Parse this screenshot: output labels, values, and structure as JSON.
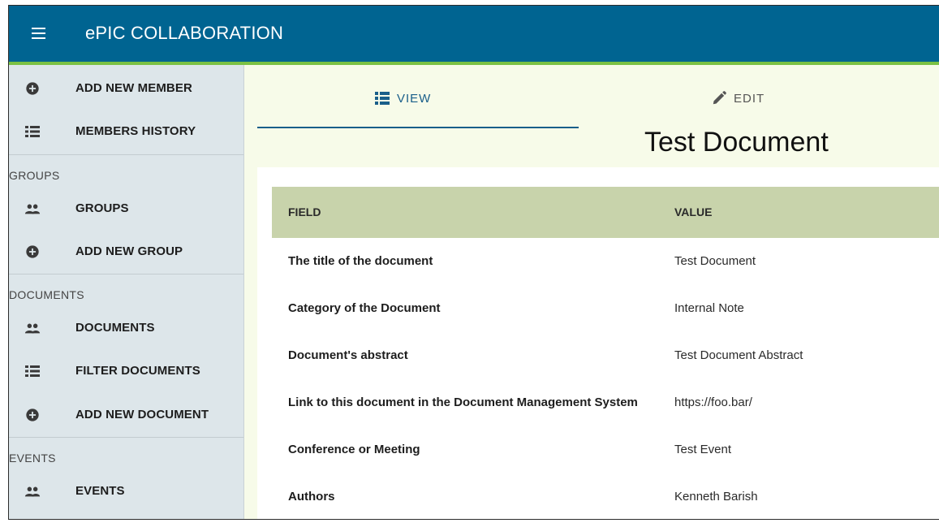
{
  "app": {
    "title": "ePIC COLLABORATION"
  },
  "sidebar": {
    "members": [
      {
        "label": "ADD NEW MEMBER",
        "icon": "add-circle-icon"
      },
      {
        "label": "MEMBERS HISTORY",
        "icon": "list-icon"
      }
    ],
    "groups_header": "GROUPS",
    "groups": [
      {
        "label": "GROUPS",
        "icon": "people-icon"
      },
      {
        "label": "ADD NEW GROUP",
        "icon": "add-circle-icon"
      }
    ],
    "documents_header": "DOCUMENTS",
    "documents": [
      {
        "label": "DOCUMENTS",
        "icon": "people-icon"
      },
      {
        "label": "FILTER DOCUMENTS",
        "icon": "list-icon"
      },
      {
        "label": "ADD NEW DOCUMENT",
        "icon": "add-circle-icon"
      }
    ],
    "events_header": "EVENTS",
    "events": [
      {
        "label": "EVENTS",
        "icon": "people-icon"
      }
    ]
  },
  "tabs": {
    "view_label": "VIEW",
    "edit_label": "EDIT"
  },
  "document": {
    "title": "Test Document",
    "table": {
      "headers": [
        "FIELD",
        "VALUE"
      ],
      "rows": [
        {
          "field": "The title of the document",
          "value": "Test Document"
        },
        {
          "field": "Category of the Document",
          "value": "Internal Note"
        },
        {
          "field": "Document's abstract",
          "value": "Test Document Abstract"
        },
        {
          "field": "Link to this document in the Document Management System",
          "value": "https://foo.bar/"
        },
        {
          "field": "Conference or Meeting",
          "value": "Test Event"
        },
        {
          "field": "Authors",
          "value": "Kenneth Barish"
        }
      ]
    }
  },
  "colors": {
    "appbar": "#006491",
    "appbar_accent": "#7bc144",
    "sidebar": "#dde6ea",
    "main_bg": "#f7fbe9",
    "table_header": "#c8d3ab",
    "tab_active": "#1a5f8a"
  }
}
